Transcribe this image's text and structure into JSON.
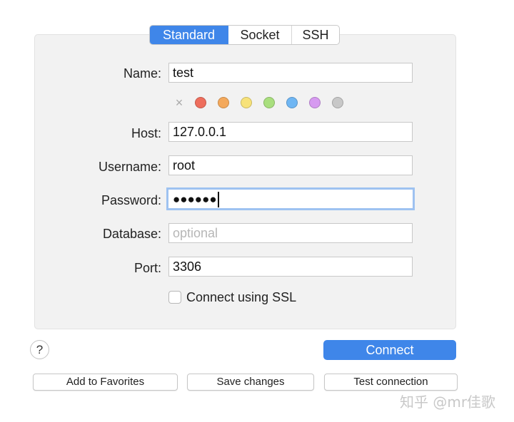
{
  "tabs": {
    "standard": "Standard",
    "socket": "Socket",
    "ssh": "SSH",
    "active": "Standard"
  },
  "form": {
    "name_label": "Name:",
    "name_value": "test",
    "host_label": "Host:",
    "host_value": "127.0.0.1",
    "username_label": "Username:",
    "username_value": "root",
    "password_label": "Password:",
    "password_value": "●●●●●●",
    "database_label": "Database:",
    "database_placeholder": "optional",
    "port_label": "Port:",
    "port_value": "3306",
    "ssl_label": "Connect using SSL",
    "ssl_checked": false
  },
  "color_tags": {
    "clear_icon": "×",
    "colors": [
      "#ee6e5d",
      "#f4a95c",
      "#f7e27a",
      "#a9df7e",
      "#6fb6f3",
      "#d69af0",
      "#c8c8c8"
    ]
  },
  "buttons": {
    "help": "?",
    "connect": "Connect",
    "add_to_favorites": "Add to Favorites",
    "save_changes": "Save changes",
    "test_connection": "Test connection"
  },
  "watermark": "知乎 @mr佳歌",
  "theme": {
    "accent": "#3f86e9",
    "focus_ring": "#9ec2f1",
    "panel_bg": "#f2f2f2"
  }
}
